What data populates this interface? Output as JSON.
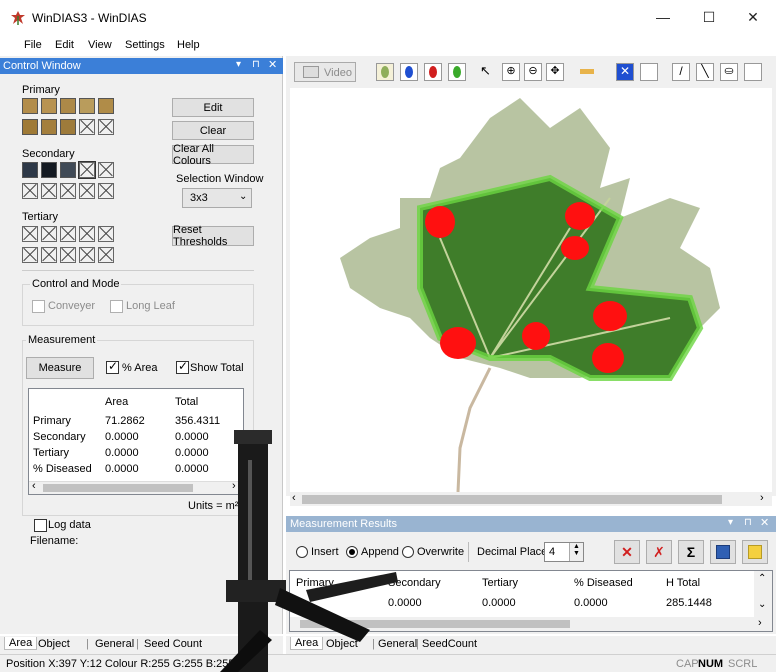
{
  "window": {
    "title": "WinDIAS3 - WinDIAS",
    "min": "—",
    "max": "☐",
    "close": "✕"
  },
  "menu": [
    "File",
    "Edit",
    "View",
    "Settings",
    "Help"
  ],
  "control_window": {
    "title": "Control Window",
    "primary_label": "Primary",
    "secondary_label": "Secondary",
    "tertiary_label": "Tertiary",
    "edit": "Edit",
    "clear": "Clear",
    "clear_all": "Clear All Colours",
    "selection_window_label": "Selection Window",
    "selection_window_value": "3x3",
    "reset_thresholds": "Reset Thresholds",
    "control_mode_label": "Control and Mode",
    "conveyer": "Conveyer",
    "long_leaf": "Long Leaf",
    "measurement_label": "Measurement",
    "measure": "Measure",
    "pct_area": "% Area",
    "show_total": "Show Total",
    "table": {
      "headers": [
        "",
        "Area",
        "Total"
      ],
      "rows": [
        [
          "Primary",
          "71.2862",
          "356.4311"
        ],
        [
          "Secondary",
          "0.0000",
          "0.0000"
        ],
        [
          "Tertiary",
          "0.0000",
          "0.0000"
        ],
        [
          "% Diseased",
          "0.0000",
          "0.0000"
        ]
      ]
    },
    "units": "Units = m²",
    "log_data": "Log data",
    "filename": "Filename:"
  },
  "toolbar": {
    "video": "Video"
  },
  "results": {
    "title": "Measurement Results",
    "insert": "Insert",
    "append": "Append",
    "overwrite": "Overwrite",
    "decimal_places_label": "Decimal Places",
    "decimal_places_value": "4",
    "headers": [
      "Primary",
      "Secondary",
      "Tertiary",
      "% Diseased",
      "H Total"
    ],
    "row1": [
      "",
      "0.0000",
      "0.0000",
      "0.0000",
      "285.1448"
    ]
  },
  "left_tabs": [
    "Area",
    "Object",
    "General",
    "Seed Count"
  ],
  "right_tabs": [
    "Area",
    "Object",
    "General",
    "SeedCount"
  ],
  "status": {
    "position": "Position  X:397 Y:12  Colour R:255 G:255 B:255)",
    "cap": "CAP",
    "num": "NUM",
    "scrl": "SCRL"
  },
  "colors": {
    "accent": "#3b7fd8",
    "lesion": "#ff1010",
    "leaf": "#5f9a45"
  }
}
